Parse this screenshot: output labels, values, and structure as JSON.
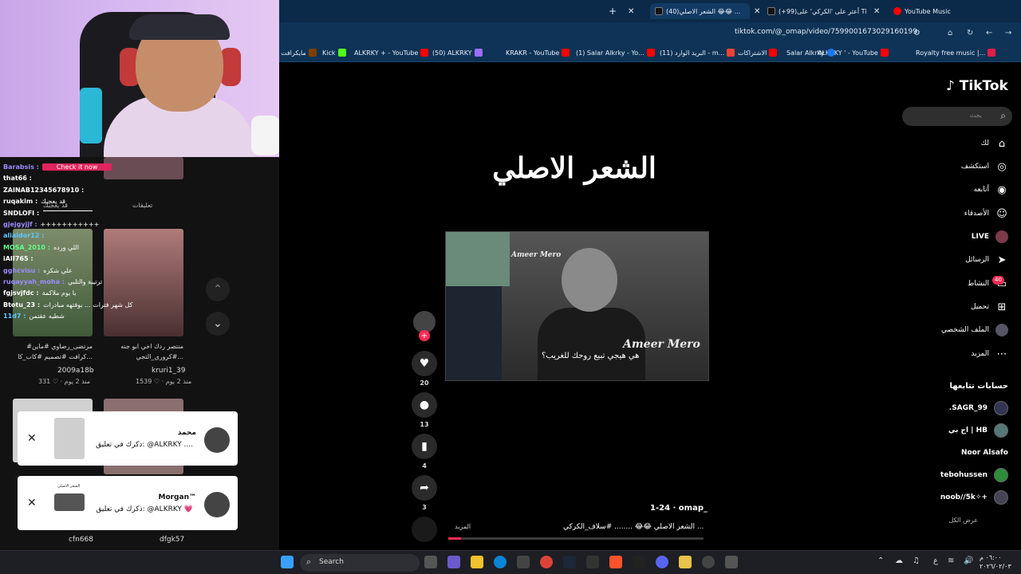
{
  "browser": {
    "tabs": [
      {
        "label": "YouTube Music",
        "color": "#ff0000"
      },
      {
        "label": "(+99)أعثر على 'الكركي' على TikTok",
        "color": "#111111"
      },
      {
        "label": "(40)الشعر الاصلي 😂😂 ...",
        "color": "#111111",
        "active": true
      }
    ],
    "new_tab_label": "+",
    "url": "tiktok.com/@_omap/video/7599001673029160199",
    "bookmarks": [
      {
        "label": "Royalty free music |...",
        "color": "#e11d48"
      },
      {
        "label": "ALKRKY ' - YouTube",
        "color": "#ff0000"
      },
      {
        "label": "Salar Alkrky",
        "color": "#1877f2"
      },
      {
        "label": "الاشتراكات",
        "color": "#ff0000"
      },
      {
        "label": "البريد الوارد (11) - m...",
        "color": "#ea4335"
      },
      {
        "label": "(1) Salar Alkrky - Yo...",
        "color": "#ff0000"
      },
      {
        "label": "KRAKR - YouTube",
        "color": "#ff0000"
      },
      {
        "label": "(50) ALKRKY",
        "color": "#9b6cff"
      },
      {
        "label": "ALKRKY + - YouTube",
        "color": "#ff0000"
      },
      {
        "label": "Kick",
        "color": "#53fc18"
      },
      {
        "label": "مايكرافت",
        "color": "#7b3f00"
      }
    ]
  },
  "chat": [
    {
      "user": "Barabsis :",
      "color": "#9b8cff",
      "text": "Check it now"
    },
    {
      "user": "that66 :",
      "color": "#ffffff",
      "text": ""
    },
    {
      "user": "ZAINAB12345678910 :",
      "color": "#ffffff",
      "text": ""
    },
    {
      "user": "ruqakim :",
      "color": "#ffffff",
      "text": "قد يعجبك"
    },
    {
      "user": "SNDLOFI :",
      "color": "#ffffff",
      "text": ""
    },
    {
      "user": "gjejgyjjf :",
      "color": "#9b8cff",
      "text": "+++++++++++"
    },
    {
      "user": "aliaidor12 :",
      "color": "#5ec8ff",
      "text": ""
    },
    {
      "user": "MOSA_2010 :",
      "color": "#5eff8a",
      "text": "اللي ورده"
    },
    {
      "user": "iAII765 :",
      "color": "#ffffff",
      "text": ""
    },
    {
      "user": "gghcvisu :",
      "color": "#9b8cff",
      "text": "علي شكره"
    },
    {
      "user": "ruqayyah_moha :",
      "color": "#9b8cff",
      "text": "ترتيبة والتلبي"
    },
    {
      "user": "fgjsvjfdc :",
      "color": "#ffffff",
      "text": "يا يوم ملاكمة"
    },
    {
      "user": "Btotu_23 :",
      "color": "#ffffff",
      "text": "كل شهر فترات ... بوفتهه مبادرات"
    },
    {
      "user": "11d7 :",
      "color": "#5ec8ff",
      "text": "شطيه عقتمن"
    }
  ],
  "left_tabs": {
    "comments": "تعليقات",
    "you_may_like": "قد يعجبك"
  },
  "videos": [
    {
      "caption": "منتصر ردك اخي ابو جنه #كروري_التجي...",
      "user": "kruri1_39",
      "likes": "1539",
      "age": "منذ 2 يوم"
    },
    {
      "caption": "#مرتضى_رضاوي #ماين كرافت #تصميم #كاب_كا...",
      "user": "2009a18b",
      "likes": "331",
      "age": "منذ 2 يوم"
    },
    {
      "caption": "",
      "user": "dfgk57",
      "likes": "",
      "age": ""
    },
    {
      "caption": "",
      "user": "cfn668",
      "likes": "",
      "age": ""
    }
  ],
  "notifications": [
    {
      "name": "محمد",
      "text": "ذكرك في تعليق: @ALKRKY ....",
      "thumb_label": ""
    },
    {
      "name": "Morgan™",
      "text": "ذكرك في تعليق: @ALKRKY 💗",
      "thumb_label": "الشعر الاصلي"
    }
  ],
  "main": {
    "title": "الشعر الاصلي",
    "video_overlay_name": "Ameer Mero",
    "video_overlay_name_small": "Ameer Mero",
    "video_subtitle": "هي هيجي تبيع روحك للغريب؟",
    "author": "omap_",
    "date": "1-24",
    "description": "الشعر الاصلي 😂😂 ........ #سلاف_الكركي ...",
    "more": "المزيد",
    "progress_fraction": 0.05,
    "actions": {
      "likes": "20",
      "comments": "13",
      "saves": "4",
      "shares": "3"
    }
  },
  "sidebar": {
    "logo": "TikTok",
    "search_placeholder": "بحث",
    "items": [
      {
        "label": "لك",
        "icon": "home-icon"
      },
      {
        "label": "استكشف",
        "icon": "compass-icon"
      },
      {
        "label": "أتابعه",
        "icon": "following-icon"
      },
      {
        "label": "الأصدقاء",
        "icon": "friends-icon"
      },
      {
        "label": "LIVE",
        "icon": "live-icon"
      },
      {
        "label": "الرسائل",
        "icon": "send-icon"
      },
      {
        "label": "النشاط",
        "icon": "inbox-icon"
      },
      {
        "label": "تحميل",
        "icon": "upload-icon"
      },
      {
        "label": "الملف الشخصي",
        "icon": "profile-icon"
      },
      {
        "label": "المزيد",
        "icon": "more-icon"
      }
    ],
    "activity_badge": "40",
    "following_title": "حسابات تتابعها",
    "following": [
      {
        "name": ".SAGR_99"
      },
      {
        "name": "اج بي | HB"
      },
      {
        "name": "Noor Alsafo"
      },
      {
        "name": "tebohussen"
      },
      {
        "name": "noob//5k✧+"
      }
    ],
    "see_all": "عرض الكل"
  },
  "taskbar": {
    "search_label": "Search",
    "time": "٠٦:٠٠ م",
    "date": "٢٠٢٦/٠٢/٠٣",
    "lang": "ع"
  }
}
